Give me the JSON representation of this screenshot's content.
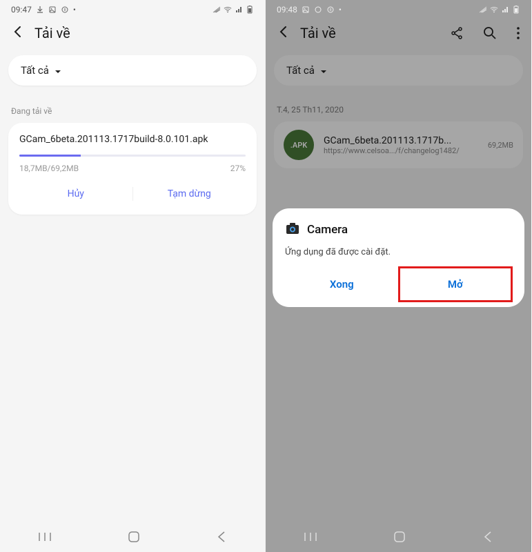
{
  "left": {
    "status": {
      "time": "09:47",
      "dot": "•"
    },
    "header": {
      "title": "Tải về"
    },
    "filter": {
      "label": "Tất cả"
    },
    "section": {
      "downloading": "Đang tải về"
    },
    "download": {
      "filename": "GCam_6beta.201113.1717build-8.0.101.apk",
      "progress_text": "18,7MB/69,2MB",
      "percent": "27%",
      "cancel": "Hủy",
      "pause": "Tạm dừng"
    }
  },
  "right": {
    "status": {
      "time": "09:48",
      "dot": "•"
    },
    "header": {
      "title": "Tải về"
    },
    "filter": {
      "label": "Tất cả"
    },
    "date": "T.4, 25 Th11, 2020",
    "file": {
      "badge": ".APK",
      "name": "GCam_6beta.201113.1717b...",
      "url": "https://www.celsoa.../f/changelog1482/",
      "size": "69,2MB"
    },
    "dialog": {
      "app": "Camera",
      "message": "Ứng dụng đã được cài đặt.",
      "done": "Xong",
      "open": "Mở"
    }
  }
}
